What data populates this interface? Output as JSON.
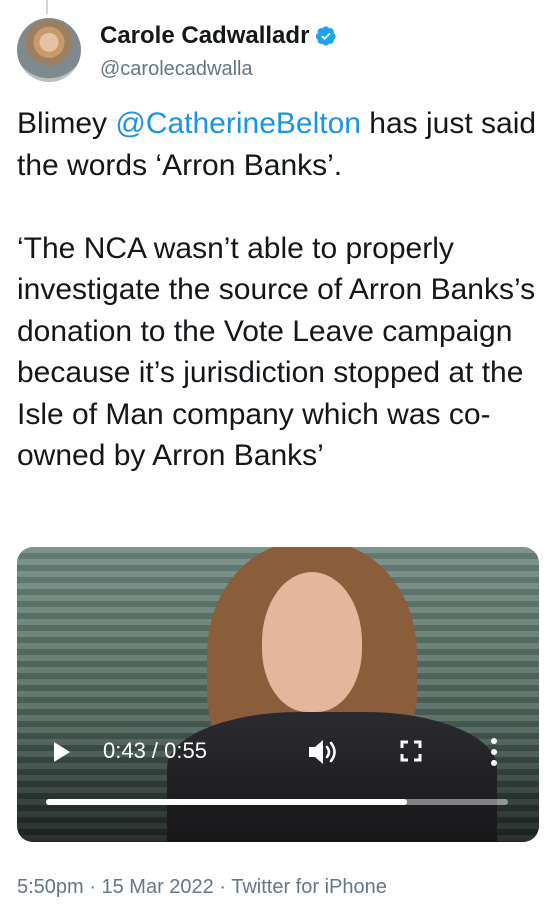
{
  "author": {
    "display_name": "Carole Cadwalladr",
    "handle": "@carolecadwalla",
    "verified": true,
    "verified_color": "#1da1f2"
  },
  "tweet": {
    "segments": [
      {
        "text": "Blimey ",
        "type": "text"
      },
      {
        "text": "@CatherineBelton",
        "type": "mention"
      },
      {
        "text": " has just said the words ‘Arron Banks’.\n\n‘The NCA wasn’t able to properly investigate the source of Arron Banks’s donation to the Vote Leave campaign because it’s jurisdiction stopped at the Isle of Man company which was co-owned by Arron Banks’",
        "type": "text"
      }
    ]
  },
  "video": {
    "time_label": "0:43 / 0:55",
    "progress_fraction": 0.782
  },
  "meta": {
    "time": "5:50pm",
    "separator": " · ",
    "date": "15 Mar 2022",
    "source": "Twitter for iPhone"
  },
  "colors": {
    "mention": "#1b95e0",
    "secondary_text": "#657786"
  },
  "icons": [
    "play-icon",
    "volume-icon",
    "fullscreen-icon",
    "more-vertical-icon",
    "verified-badge-icon"
  ]
}
